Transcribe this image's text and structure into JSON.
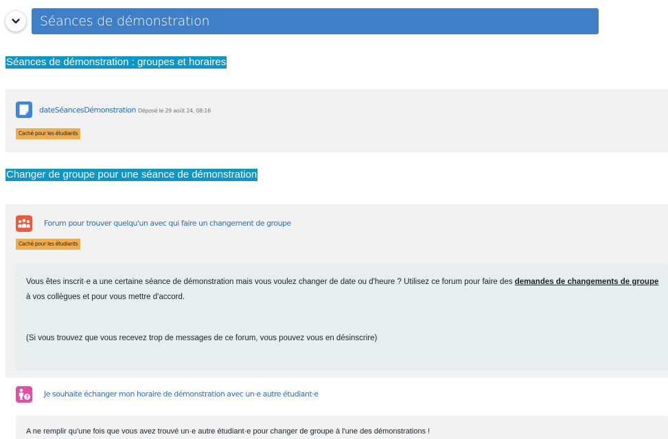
{
  "section": {
    "title": "Séances de démonstration",
    "toggle_icon": "chevron-down-icon"
  },
  "headings": {
    "groups_schedule": "Séances de démonstration : groupes et horaires",
    "change_group": "Changer de groupe pour une séance de démonstration"
  },
  "activity_date": {
    "icon": "file-icon",
    "icon_color": "#3d86d8",
    "name": "dateSéancesDémonstration",
    "meta": "Déposé le 29 août 24, 08:16",
    "badge": "Caché pour les étudiants"
  },
  "activity_forum": {
    "icon": "forum-icon",
    "icon_color": "#ee5b3c",
    "name": "Forum pour trouver quelqu'un avec qui faire un changement de groupe",
    "badge": "Caché pour les étudiants",
    "description": {
      "line1_before": "Vous êtes inscrit·e a une certaine séance de démonstration mais vous voulez changer de date ou d'heure ? Utilisez ce forum pour faire des ",
      "link": "demandes de changements de groupe",
      "line1_after": " à vos collègues et pour vous mettre d'accord.",
      "line2": "(Si vous trouvez que vous recevez trop de messages de ce forum, vous pouvez vous en désinscrire)"
    }
  },
  "activity_choice": {
    "icon": "person-question-icon",
    "icon_color": "#e24ea4",
    "name": "Je souhaite échanger mon horaire de démonstration avec un·e autre étudiant·e",
    "description": "A ne remplir qu'une fois que vous avez trouvé un·e autre étudiant·e pour changer de groupe à l'une des démonstrations !"
  },
  "colors": {
    "section_bar": "#3f7fc7",
    "heading_highlight": "#0e96c9",
    "badge": "#f0ad4e",
    "link": "#2a6ebd"
  }
}
